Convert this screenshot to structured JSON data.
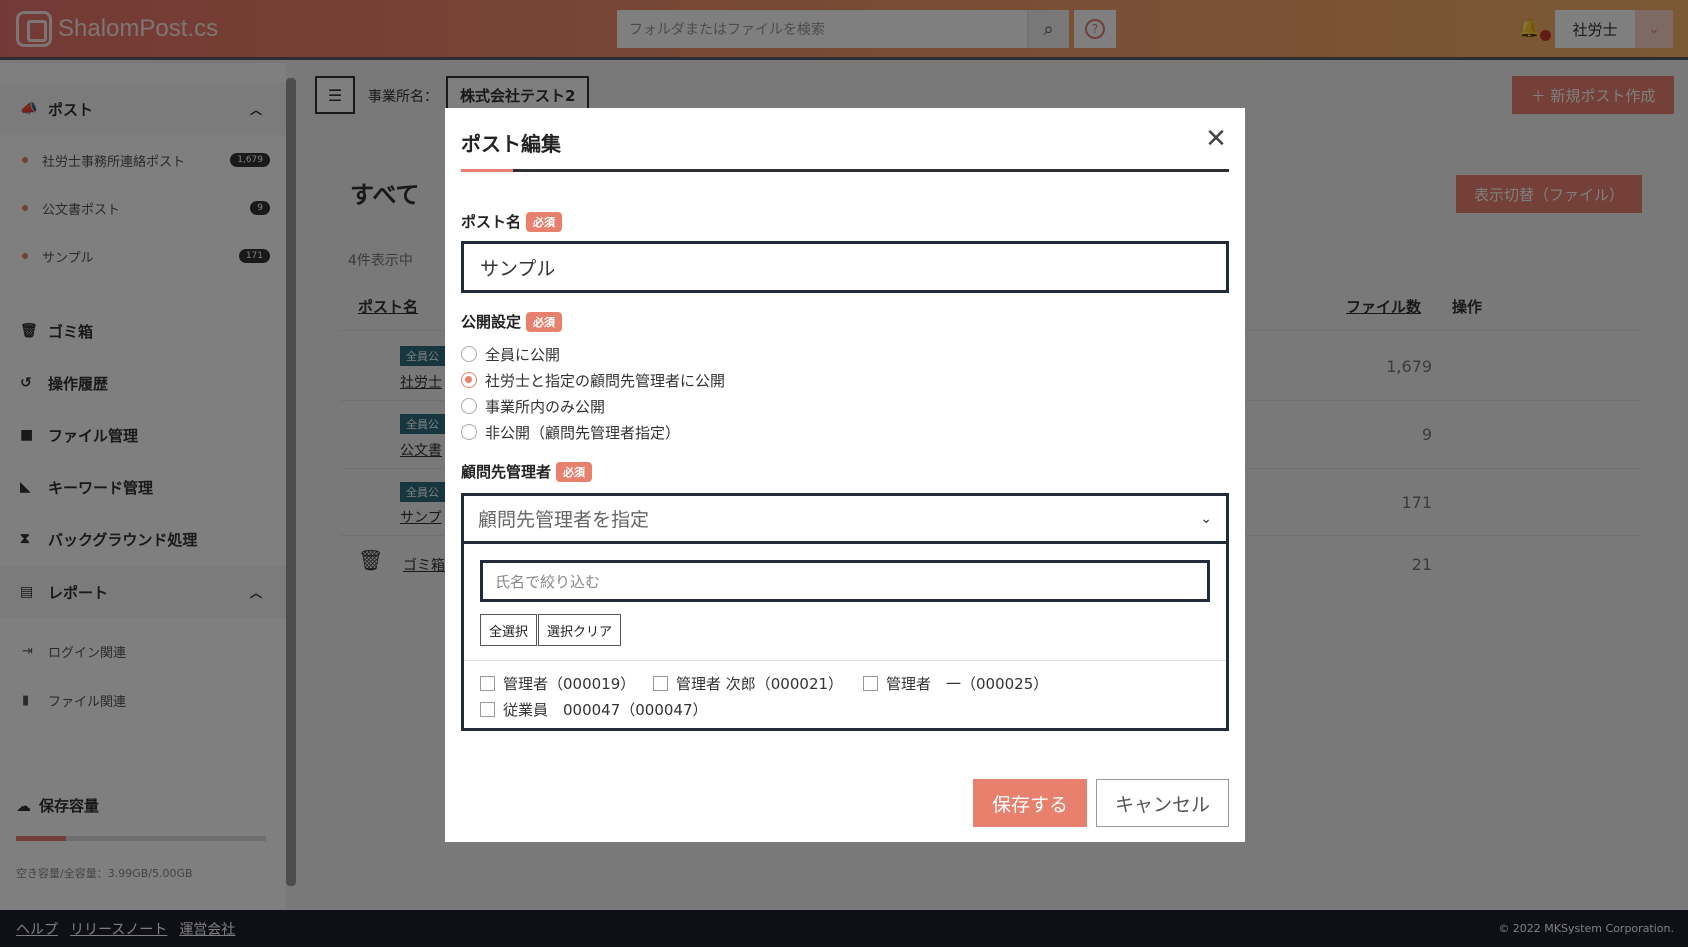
{
  "app": {
    "logo_text": "ShalomPost.cs"
  },
  "header": {
    "search_placeholder": "フォルダまたはファイルを検索",
    "user_label": "社労士"
  },
  "sidebar": {
    "post_group": "ポスト",
    "post_items": [
      {
        "label": "社労士事務所連絡ポスト",
        "badge": "1,679"
      },
      {
        "label": "公文書ポスト",
        "badge": "9"
      },
      {
        "label": "サンプル",
        "badge": "171"
      }
    ],
    "main_items": [
      "ゴミ箱",
      "操作履歴",
      "ファイル管理",
      "キーワード管理",
      "バックグラウンド処理"
    ],
    "report_group": "レポート",
    "report_items": [
      "ログイン関連",
      "ファイル関連"
    ],
    "storage_title": "保存容量",
    "storage_text": "空き容量/全容量：3.99GB/5.00GB",
    "storage_used_fraction": 0.2
  },
  "breadcrumb": {
    "label": "事業所名：",
    "value": "株式会社テスト2"
  },
  "toolbar": {
    "new_post": "＋ 新規ポスト作成",
    "view_toggle": "表示切替（ファイル）"
  },
  "page": {
    "title": "すべて",
    "count": "4件表示中"
  },
  "table": {
    "headers": {
      "name": "ポスト名",
      "files": "ファイル数",
      "ops": "操作"
    },
    "rows": [
      {
        "name": "社労士",
        "tag": "全員公",
        "files": "1,679"
      },
      {
        "name": "公文書",
        "tag": "全員公",
        "files": "9"
      },
      {
        "name": "サンプ",
        "tag": "全員公",
        "files": "171"
      },
      {
        "name": "ゴミ箱",
        "files": "21"
      }
    ]
  },
  "footer": {
    "links": [
      "ヘルプ",
      "リリースノート",
      "運営会社"
    ],
    "copyright": "© 2022 MKSystem Corporation."
  },
  "modal": {
    "title": "ポスト編集",
    "required_badge": "必須",
    "post_name_label": "ポスト名",
    "post_name_value": "サンプル",
    "visibility_label": "公開設定",
    "visibility_options": [
      {
        "label": "全員に公開",
        "selected": false
      },
      {
        "label": "社労士と指定の顧問先管理者に公開",
        "selected": true
      },
      {
        "label": "事業所内のみ公開",
        "selected": false
      },
      {
        "label": "非公開（顧問先管理者指定）",
        "selected": false
      }
    ],
    "managers_label": "顧問先管理者",
    "managers_placeholder": "顧問先管理者を指定",
    "filter_placeholder": "氏名で絞り込む",
    "select_all": "全選択",
    "clear_selection": "選択クリア",
    "managers": [
      "管理者（000019）",
      "管理者 次郎（000021）",
      "管理者　一（000025）",
      "従業員　000047（000047）"
    ],
    "save": "保存する",
    "cancel": "キャンセル"
  },
  "colors": {
    "accent": "#e8806e",
    "dark": "#222b3a"
  }
}
